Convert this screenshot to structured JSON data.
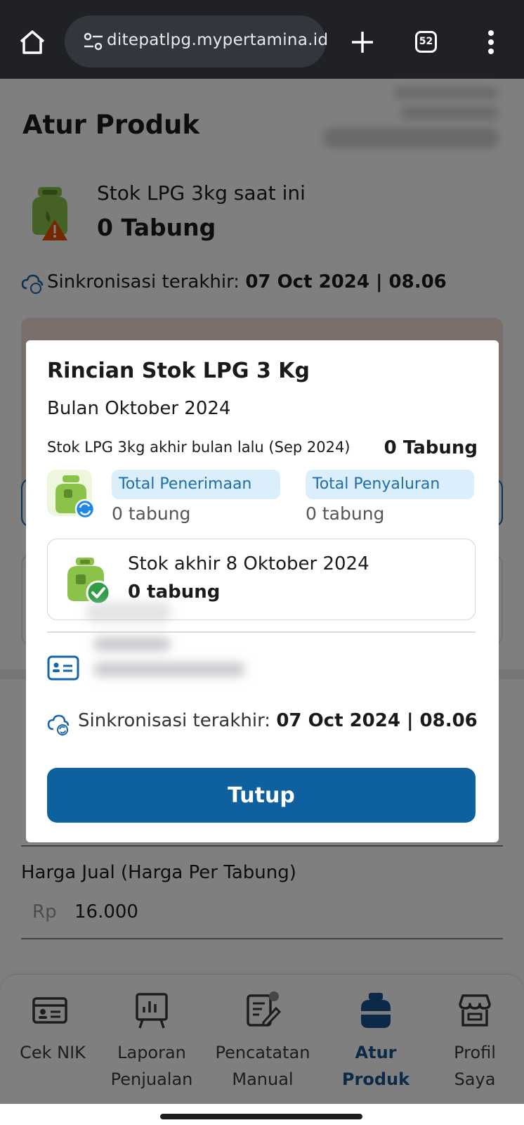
{
  "browser": {
    "url": "ditepatlpg.mypertamina.id",
    "tab_count": "52"
  },
  "page": {
    "title": "Atur Produk",
    "stock_label": "Stok LPG 3kg saat ini",
    "stock_value": "0 Tabung",
    "sync_label": "Sinkronisasi terakhir:",
    "sync_value": "07 Oct 2024 | 08.06",
    "price_label": "Harga Jual (Harga Per Tabung)",
    "price_prefix": "Rp",
    "price_value": "16.000"
  },
  "modal": {
    "title": "Rincian Stok LPG 3 Kg",
    "subtitle": "Bulan Oktober 2024",
    "prev_stock_label": "Stok LPG 3kg akhir bulan lalu (Sep 2024)",
    "prev_stock_value": "0 Tabung",
    "received_label": "Total Penerimaan",
    "received_value": "0 tabung",
    "distributed_label": "Total Penyaluran",
    "distributed_value": "0 tabung",
    "end_stock_label": "Stok akhir 8 Oktober 2024",
    "end_stock_value": "0 tabung",
    "sync_label": "Sinkronisasi terakhir:",
    "sync_value": "07 Oct 2024 | 08.06",
    "close_label": "Tutup"
  },
  "nav": {
    "items": [
      {
        "label": "Cek NIK",
        "icon": "id-card-icon"
      },
      {
        "label": "Laporan\nPenjualan",
        "icon": "report-chart-icon"
      },
      {
        "label": "Pencatatan\nManual",
        "icon": "manual-note-icon"
      },
      {
        "label": "Atur\nProduk",
        "icon": "gas-cylinder-icon",
        "active": true
      },
      {
        "label": "Profil\nSaya",
        "icon": "store-icon"
      }
    ]
  },
  "colors": {
    "primary": "#0f609e",
    "pill_bg": "#dbeefb",
    "lpg_green": "#8bc34a",
    "warning": "#e65100",
    "success": "#2e9d45"
  }
}
